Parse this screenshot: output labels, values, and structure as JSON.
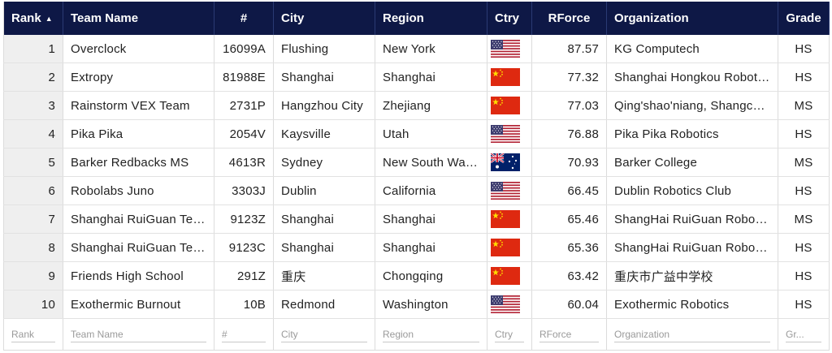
{
  "columns": {
    "rank": "Rank",
    "team_name": "Team Name",
    "number": "#",
    "city": "City",
    "region": "Region",
    "country": "Ctry",
    "rforce": "RForce",
    "organization": "Organization",
    "grade": "Grade"
  },
  "sort_indicator": "▲",
  "rows": [
    {
      "rank": "1",
      "team": "Overclock",
      "number": "16099A",
      "city": "Flushing",
      "region": "New York",
      "flag": "us-flag-icon",
      "rforce": "87.57",
      "org": "KG Computech",
      "grade": "HS"
    },
    {
      "rank": "2",
      "team": "Extropy",
      "number": "81988E",
      "city": "Shanghai",
      "region": "Shanghai",
      "flag": "cn-flag-icon",
      "rforce": "77.32",
      "org": "Shanghai Hongkou Robotics",
      "grade": "HS"
    },
    {
      "rank": "3",
      "team": "Rainstorm VEX Team",
      "number": "2731P",
      "city": "Hangzhou City",
      "region": "Zhejiang",
      "flag": "cn-flag-icon",
      "rforce": "77.03",
      "org": "Qing'shao'niang, Shangcheng",
      "grade": "MS"
    },
    {
      "rank": "4",
      "team": "Pika Pika",
      "number": "2054V",
      "city": "Kaysville",
      "region": "Utah",
      "flag": "us-flag-icon",
      "rforce": "76.88",
      "org": "Pika Pika Robotics",
      "grade": "HS"
    },
    {
      "rank": "5",
      "team": "Barker Redbacks MS",
      "number": "4613R",
      "city": "Sydney",
      "region": "New South Wales",
      "flag": "au-flag-icon",
      "rforce": "70.93",
      "org": "Barker College",
      "grade": "MS"
    },
    {
      "rank": "6",
      "team": "Robolabs Juno",
      "number": "3303J",
      "city": "Dublin",
      "region": "California",
      "flag": "us-flag-icon",
      "rforce": "66.45",
      "org": "Dublin Robotics Club",
      "grade": "HS"
    },
    {
      "rank": "7",
      "team": "Shanghai RuiGuan Team",
      "number": "9123Z",
      "city": "Shanghai",
      "region": "Shanghai",
      "flag": "cn-flag-icon",
      "rforce": "65.46",
      "org": "ShangHai RuiGuan Robotics",
      "grade": "MS"
    },
    {
      "rank": "8",
      "team": "Shanghai RuiGuan Team",
      "number": "9123C",
      "city": "Shanghai",
      "region": "Shanghai",
      "flag": "cn-flag-icon",
      "rforce": "65.36",
      "org": "ShangHai RuiGuan Robotics",
      "grade": "HS"
    },
    {
      "rank": "9",
      "team": "Friends High School",
      "number": "291Z",
      "city": "重庆",
      "region": "Chongqing",
      "flag": "cn-flag-icon",
      "rforce": "63.42",
      "org": "重庆市广益中学校",
      "grade": "HS"
    },
    {
      "rank": "10",
      "team": "Exothermic Burnout",
      "number": "10B",
      "city": "Redmond",
      "region": "Washington",
      "flag": "us-flag-icon",
      "rforce": "60.04",
      "org": "Exothermic Robotics",
      "grade": "HS"
    }
  ],
  "filters": {
    "rank": "Rank",
    "team_name": "Team Name",
    "number": "#",
    "city": "City",
    "region": "Region",
    "country": "Ctry",
    "rforce": "RForce",
    "organization": "Organization",
    "grade": "Gr..."
  },
  "colors": {
    "header_bg": "#0e1846",
    "header_text": "#ffffff",
    "rank_bg": "#efefef"
  }
}
